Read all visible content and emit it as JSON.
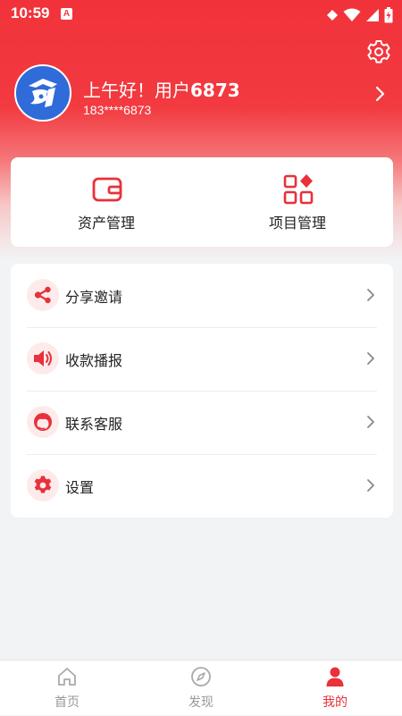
{
  "status_bar": {
    "time": "10:59",
    "notification_badge": "A"
  },
  "header": {
    "greeting_prefix": "上午好！用户",
    "username_number": "6873",
    "phone_masked": "183****6873"
  },
  "assets_card": {
    "items": [
      {
        "label": "资产管理",
        "icon": "wallet-icon"
      },
      {
        "label": "项目管理",
        "icon": "grid-diamond-icon"
      }
    ]
  },
  "menu": {
    "items": [
      {
        "label": "分享邀请",
        "icon": "share-icon"
      },
      {
        "label": "收款播报",
        "icon": "speaker-icon"
      },
      {
        "label": "联系客服",
        "icon": "customer-service-icon"
      },
      {
        "label": "设置",
        "icon": "gear-icon"
      }
    ]
  },
  "tabbar": {
    "tabs": [
      {
        "label": "首页",
        "icon": "home-icon",
        "active": false
      },
      {
        "label": "发现",
        "icon": "compass-icon",
        "active": false
      },
      {
        "label": "我的",
        "icon": "user-icon",
        "active": true
      }
    ]
  },
  "colors": {
    "brand_red": "#F23A40",
    "icon_red": "#E8313A",
    "icon_bg": "#FDEBEB",
    "page_bg": "#F2F3F5",
    "avatar_blue": "#2F6BD9",
    "inactive_tab": "#999999"
  }
}
